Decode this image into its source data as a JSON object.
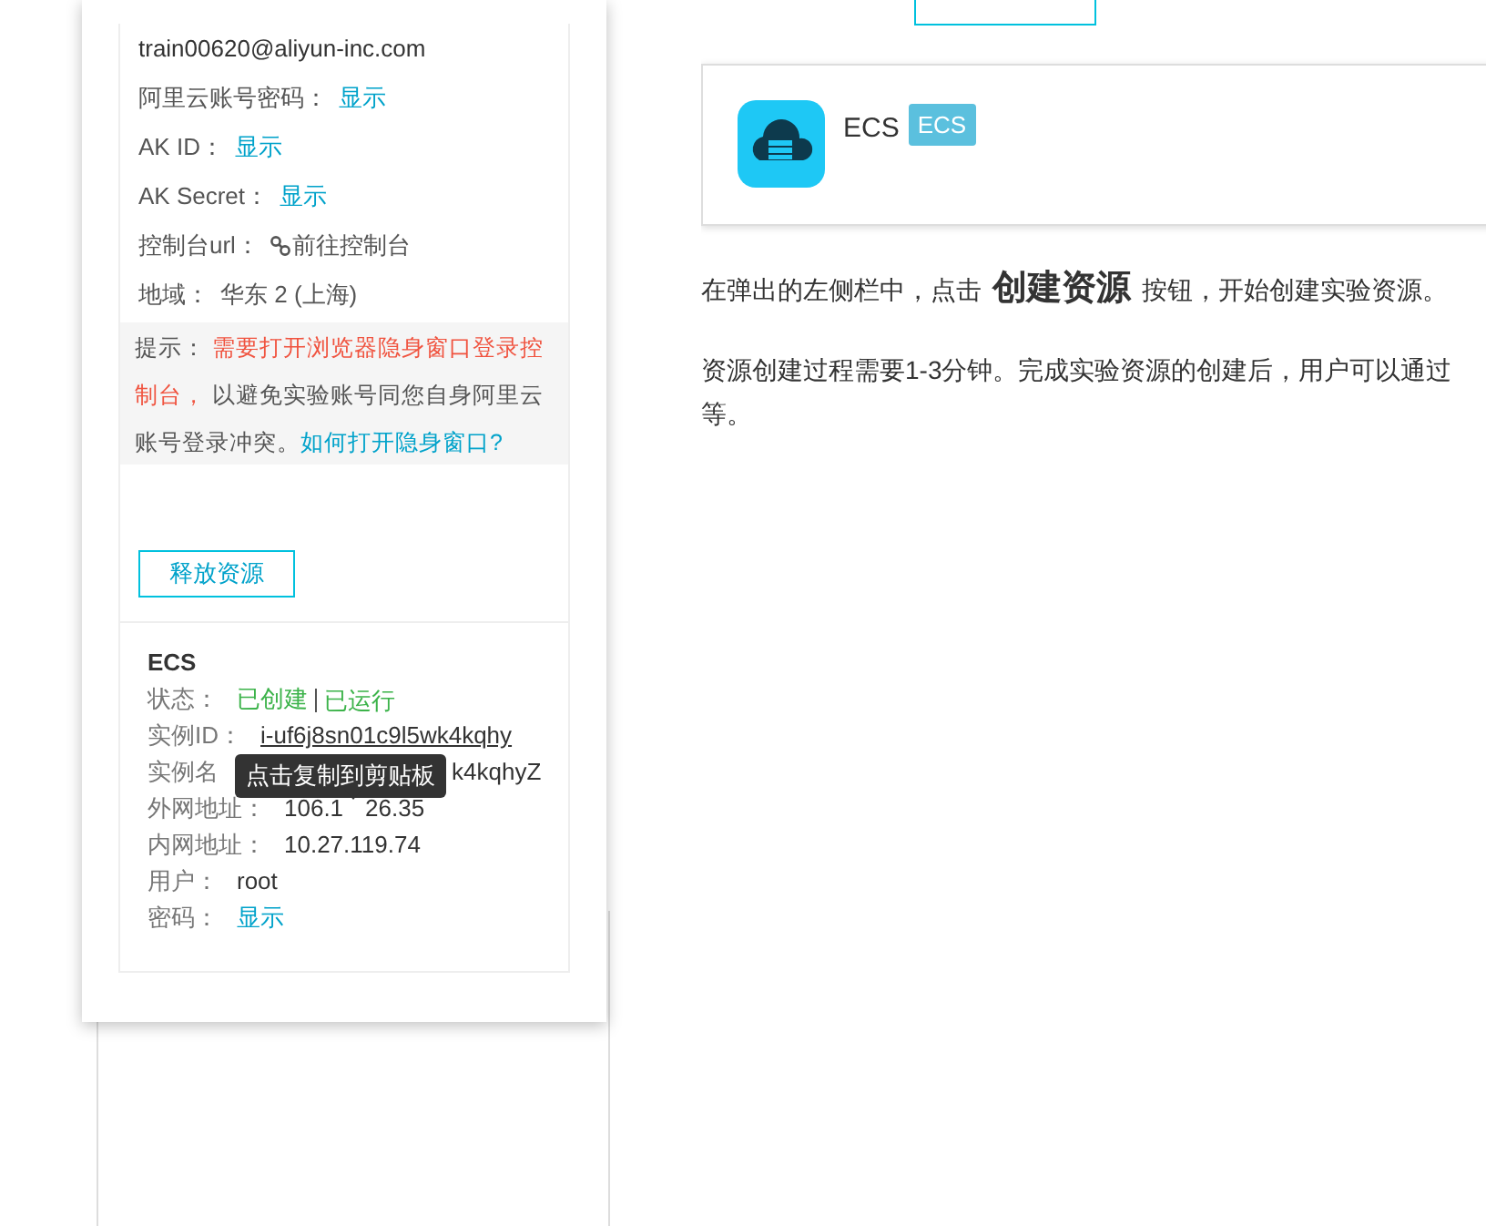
{
  "left_panel": {
    "account": "train00620@aliyun-inc.com",
    "fields": [
      {
        "label": "阿里云账号密码：",
        "value": "显示",
        "kind": "link"
      },
      {
        "label": "AK ID：",
        "value": "显示",
        "kind": "link"
      },
      {
        "label": "AK Secret：",
        "value": "显示",
        "kind": "link"
      },
      {
        "label": "控制台url：",
        "value": "前往控制台",
        "kind": "console"
      },
      {
        "label": "地域：",
        "value": "华东 2 (上海)",
        "kind": "text"
      }
    ],
    "hint": {
      "label": "提示：",
      "warning": "需要打开浏览器隐身窗口登录控制台，",
      "text": " 以避免实验账号同您自身阿里云账号登录冲突。",
      "link": "如何打开隐身窗口?"
    },
    "release_button": "释放资源",
    "resource": {
      "title": "ECS",
      "rows": [
        {
          "label": "状态：",
          "kind": "status",
          "values": [
            "已创建",
            "已运行"
          ]
        },
        {
          "label": "实例ID：",
          "kind": "underline",
          "value": "i-uf6j8sn01c9l5wk4kqhy"
        },
        {
          "label": "实例名",
          "kind": "partial",
          "value": "k4kqhyZ"
        },
        {
          "label": "外网地址：",
          "kind": "split",
          "values": [
            "106.1",
            "26.35"
          ]
        },
        {
          "label": "内网地址：",
          "kind": "text",
          "value": "10.27.119.74"
        },
        {
          "label": "用户：",
          "kind": "text",
          "value": "root"
        },
        {
          "label": "密码：",
          "kind": "link",
          "value": "显示"
        }
      ]
    },
    "tooltip": "点击复制到剪贴板"
  },
  "content": {
    "resource_card": {
      "name": "ECS",
      "badge": "ECS"
    },
    "step": {
      "before": "在弹出的左侧栏中，点击",
      "emphasis": "创建资源",
      "after": "按钮，开始创建实验资源。"
    },
    "note_lines": [
      "资源创建过程需要1-3分钟。完成实验资源的创建后，用户可以通过",
      "等。"
    ]
  }
}
